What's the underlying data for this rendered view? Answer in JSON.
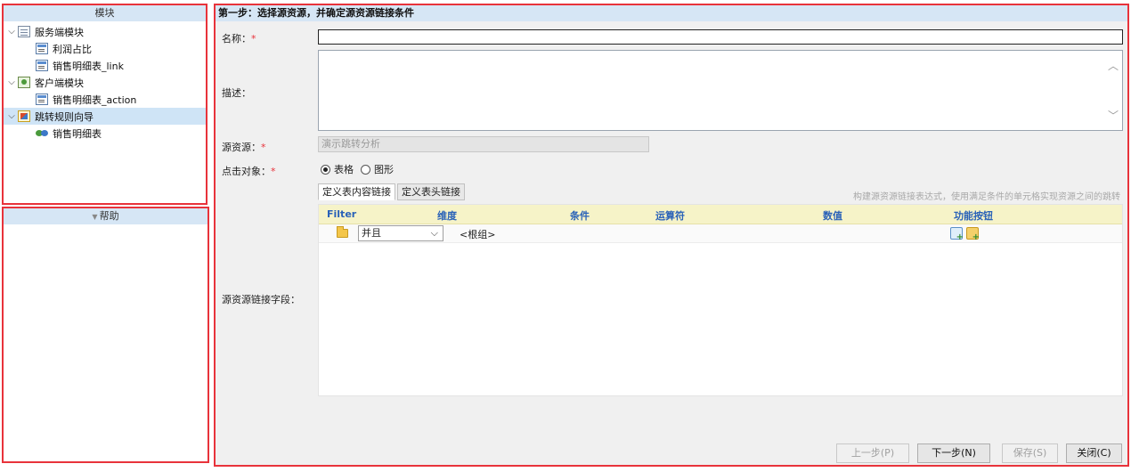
{
  "module_panel": {
    "title": "模块",
    "tree": [
      {
        "label": "服务端模块",
        "icon": "tree-folder-icon",
        "level": 0,
        "expanded": true
      },
      {
        "label": "利润占比",
        "icon": "report-icon",
        "level": 1
      },
      {
        "label": "销售明细表_link",
        "icon": "report-icon",
        "level": 1
      },
      {
        "label": "客户端模块",
        "icon": "client-folder-icon",
        "level": 0,
        "expanded": true
      },
      {
        "label": "销售明细表_action",
        "icon": "report-icon",
        "level": 1
      },
      {
        "label": "跳转规则向导",
        "icon": "jump-rule-icon",
        "level": 0,
        "expanded": true,
        "selected": true
      },
      {
        "label": "销售明细表",
        "icon": "link-rule-icon",
        "level": 1
      }
    ]
  },
  "help_panel": {
    "title": "帮助"
  },
  "wizard": {
    "step_title": "第一步：选择源资源，并确定源资源链接条件",
    "name_label": "名称：",
    "name_value": "",
    "desc_label": "描述：",
    "desc_value": "",
    "source_label": "源资源：",
    "source_value": "演示跳转分析",
    "click_target_label": "点击对象：",
    "required_mark": "*",
    "radio_options": [
      {
        "label": "表格",
        "checked": true
      },
      {
        "label": "图形",
        "checked": false
      }
    ],
    "link_fields_label": "源资源链接字段：",
    "tabs": [
      {
        "label": "定义表内容链接",
        "active": true
      },
      {
        "label": "定义表头链接",
        "active": false
      }
    ],
    "tab_hint": "构建源资源链接表达式，使用满足条件的单元格实现资源之间的跳转",
    "grid": {
      "columns": [
        "Filter",
        "维度",
        "条件",
        "运算符",
        "数值",
        "功能按钮"
      ],
      "rows": [
        {
          "operator": "并且",
          "group": "<根组>"
        }
      ]
    },
    "buttons": {
      "prev": "上一步(P)",
      "next": "下一步(N)",
      "save": "保存(S)",
      "close": "关闭(C)"
    }
  },
  "colors": {
    "highlight_border": "#e8333b",
    "panel_header_bg": "#d6e6f5",
    "grid_header_bg": "#f6f3c8",
    "grid_header_text": "#2a62b8"
  }
}
